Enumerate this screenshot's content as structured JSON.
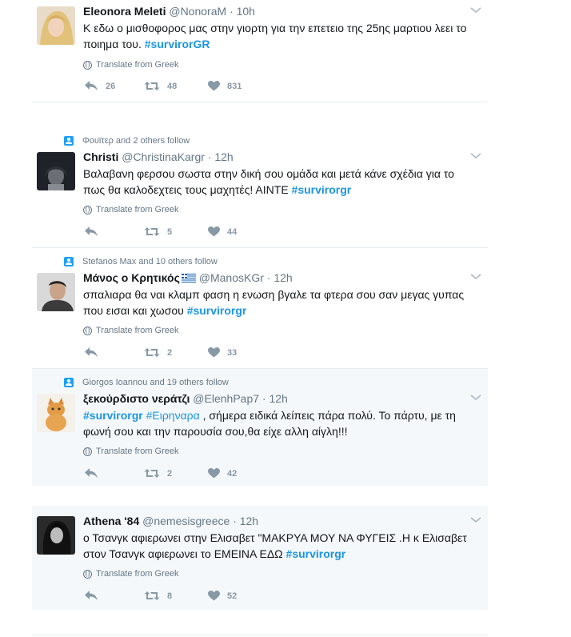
{
  "tweets": [
    {
      "social_context": "",
      "name": "Eleonora Meleti",
      "handle": "@NonoraM",
      "time": "· 10h",
      "text": "Κ εδω ο μισθοφορος μας στην γιορτη για την επετειο της 25ης μαρτιου λεει το ποιημα του.",
      "text_line2_tail": "",
      "hashtags": [
        "#survirorGR"
      ],
      "translate": "Translate from Greek",
      "replies": "26",
      "retweets": "48",
      "likes": "831"
    },
    {
      "social_context": "Φουϊτερ and 2 others follow",
      "name": "Christi",
      "handle": "@ChristinaKargr",
      "time": "· 12h",
      "text": "Βαλαβανη φερσου σωστα στην δική σου ομάδα και μετά κάνε σχέδια για το πως θα καλοδεχτεις τους μαχητές! ΑΙΝΤΕ",
      "hashtags": [
        "#survirorgr"
      ],
      "translate": "Translate from Greek",
      "replies": "",
      "retweets": "5",
      "likes": "44"
    },
    {
      "social_context": "Stefanos Max and 10 others follow",
      "name": "Μάνος ο Κρητικός",
      "handle": "@ManosKGr",
      "time": "· 12h",
      "text": "σπαλιαρα θα ναι κλαμπ φαση η ενωση βγαλε τα φτερα σου σαν μεγας γυπας που εισαι και χωσου",
      "hashtags": [
        "#survirorgr"
      ],
      "translate": "Translate from Greek",
      "replies": "",
      "retweets": "2",
      "likes": "33"
    },
    {
      "social_context": "Giorgos Ioannou and 19 others follow",
      "name": "ξεκούρδιστο νεράτζι",
      "handle": "@ElenhPap7",
      "time": "· 12h",
      "text": ", σήμερα ειδικά λείπεις πάρα πολύ. Το πάρτυ, με τη φωνή σου και την παρουσία σου,θα είχε αλλη αίγλη!!!",
      "hashtags": [
        "#survirorgr",
        "#Ειρηναρα"
      ],
      "translate": "Translate from Greek",
      "replies": "",
      "retweets": "2",
      "likes": "42"
    },
    {
      "social_context": "",
      "name": "Athena '84",
      "handle": "@nemesisgreece",
      "time": "· 12h",
      "text": "ο Τσανγκ αφιερωνει στην Ελισαβετ  \"ΜΑΚΡΥΑ ΜΟΥ ΝΑ ΦΥΓΕΙΣ .Η κ Ελισαβετ στον Τσανγκ αφιερωνει το ΕΜΕΙΝΑ ΕΔΩ",
      "hashtags": [
        "#survirorgr"
      ],
      "translate": "Translate from Greek",
      "replies": "",
      "retweets": "8",
      "likes": "52"
    }
  ],
  "colors": {
    "link": "#1b95e0",
    "muted": "#657786",
    "icon": "#8899a6",
    "highlight_bg": "#f5f8fa"
  },
  "icons": {
    "reply": "reply-icon",
    "retweet": "retweet-icon",
    "like": "heart-icon",
    "more": "chevron-down-icon",
    "translate": "globe-icon",
    "social": "person-icon"
  }
}
